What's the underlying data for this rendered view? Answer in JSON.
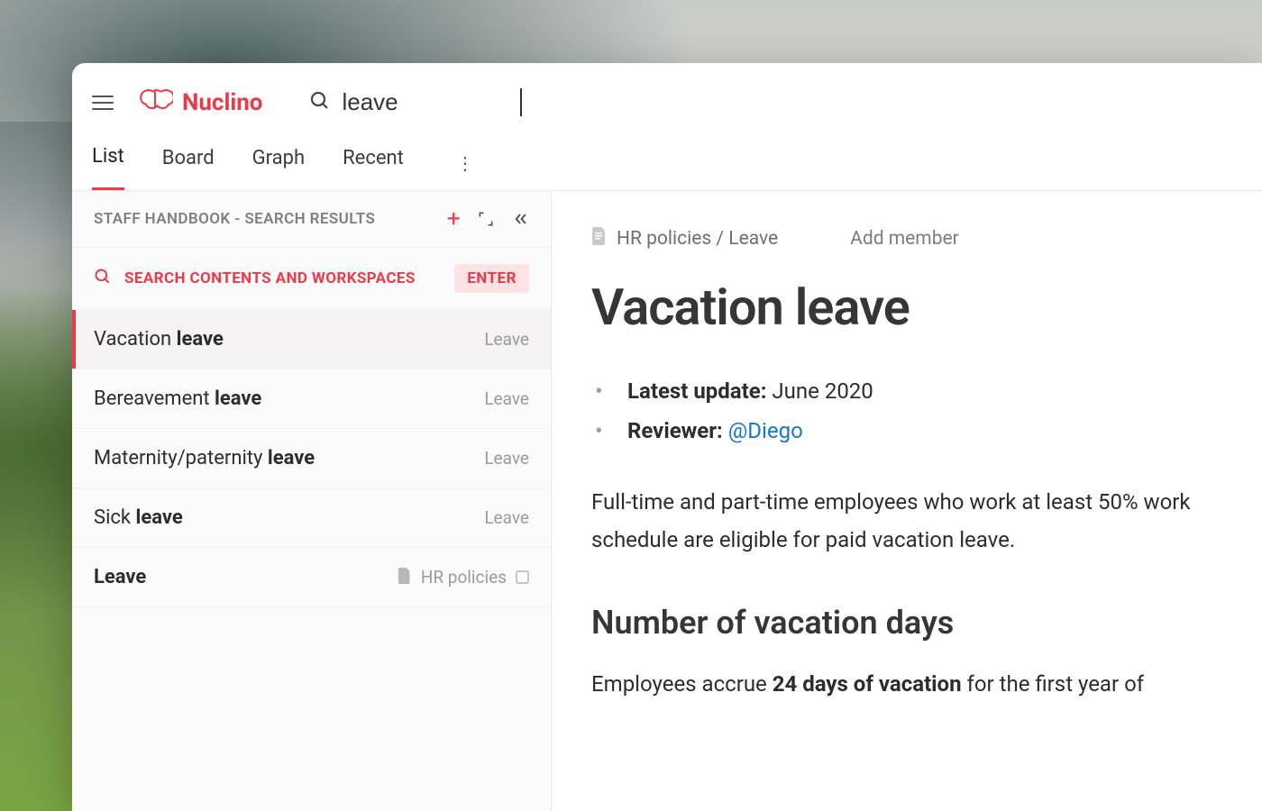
{
  "brand": "Nuclino",
  "search": {
    "value": "leave"
  },
  "tabs": [
    {
      "label": "List",
      "active": true
    },
    {
      "label": "Board",
      "active": false
    },
    {
      "label": "Graph",
      "active": false
    },
    {
      "label": "Recent",
      "active": false
    }
  ],
  "sidebar": {
    "header": "STAFF HANDBOOK - SEARCH RESULTS",
    "search_all_label": "SEARCH CONTENTS AND WORKSPACES",
    "enter_badge": "ENTER",
    "results": [
      {
        "prefix": "Vacation ",
        "bold": "leave",
        "category": "Leave",
        "selected": true,
        "is_collection": false
      },
      {
        "prefix": "Bereavement ",
        "bold": "leave",
        "category": "Leave",
        "selected": false,
        "is_collection": false
      },
      {
        "prefix": "Maternity/paternity ",
        "bold": "leave",
        "category": "Leave",
        "selected": false,
        "is_collection": false
      },
      {
        "prefix": "Sick ",
        "bold": "leave",
        "category": "Leave",
        "selected": false,
        "is_collection": false
      },
      {
        "prefix": "",
        "bold": "Leave",
        "category": "HR policies",
        "selected": false,
        "is_collection": true
      }
    ]
  },
  "content": {
    "breadcrumb": "HR policies / Leave",
    "add_member": "Add member",
    "title": "Vacation leave",
    "meta_update_label": "Latest update:",
    "meta_update_value": "June 2020",
    "meta_reviewer_label": "Reviewer:",
    "meta_reviewer_mention": "@Diego",
    "paragraph": "Full-time and part-time employees who work at least 50% work schedule are eligible for paid vacation leave.",
    "subheading": "Number of vacation days",
    "paragraph2_pre": "Employees accrue ",
    "paragraph2_bold": "24 days of vacation",
    "paragraph2_post": " for the first year of"
  }
}
